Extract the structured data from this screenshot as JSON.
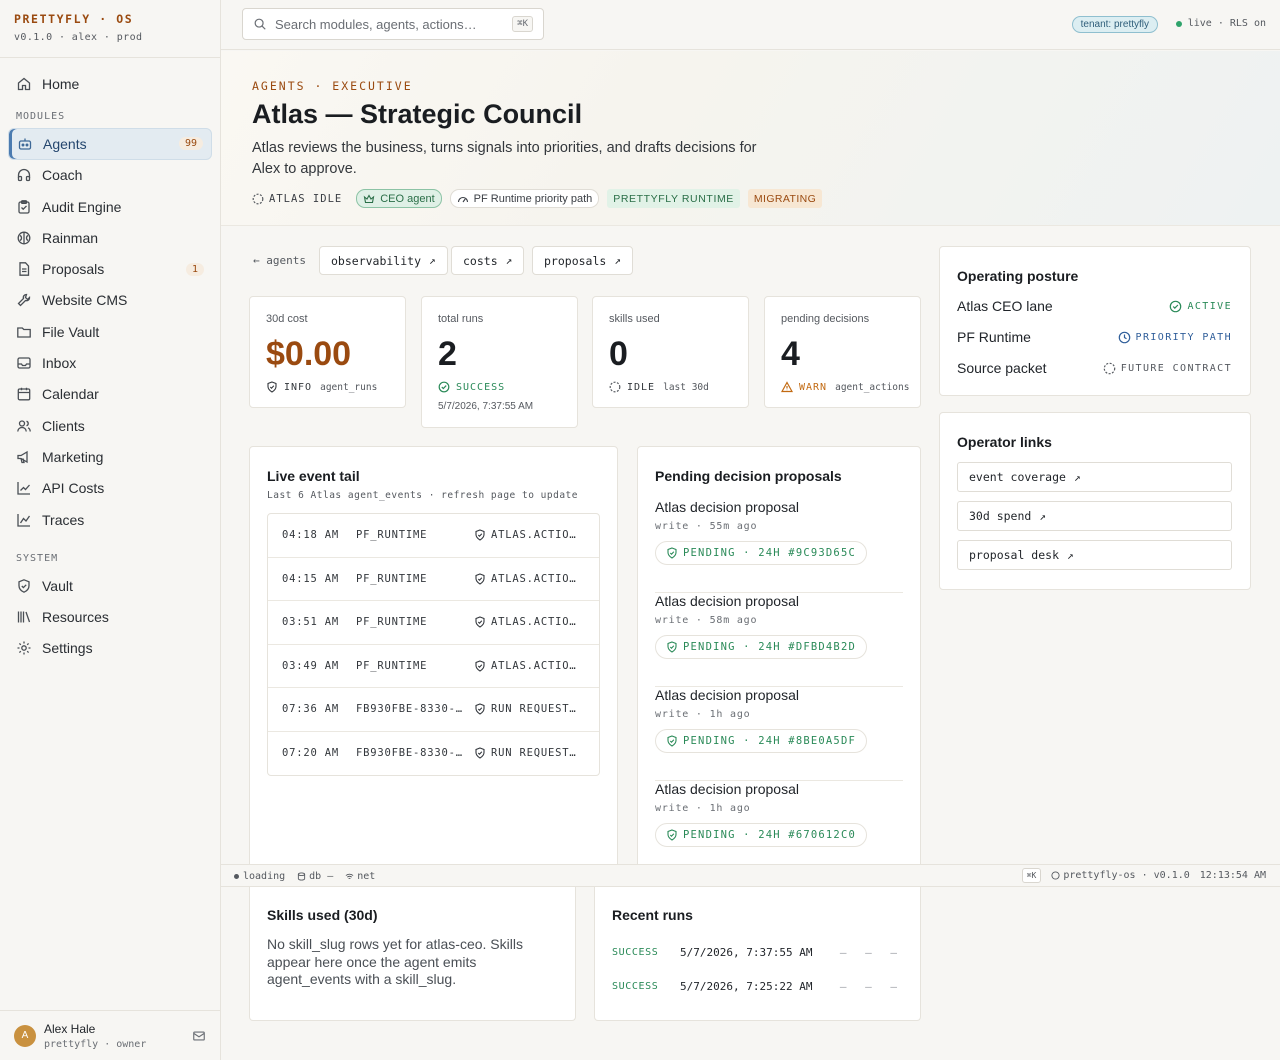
{
  "app": {
    "brand": "PRETTYFLY · OS",
    "version_line": "v0.1.0 · alex · prod"
  },
  "sidebar": {
    "home": "Home",
    "modules_label": "MODULES",
    "modules": [
      {
        "label": "Agents",
        "badge": "99"
      },
      {
        "label": "Coach"
      },
      {
        "label": "Audit Engine"
      },
      {
        "label": "Rainman"
      },
      {
        "label": "Proposals",
        "badge": "1"
      },
      {
        "label": "Website CMS"
      },
      {
        "label": "File Vault"
      },
      {
        "label": "Inbox"
      },
      {
        "label": "Calendar"
      },
      {
        "label": "Clients"
      },
      {
        "label": "Marketing"
      },
      {
        "label": "API Costs"
      },
      {
        "label": "Traces"
      }
    ],
    "system_label": "SYSTEM",
    "system": [
      {
        "label": "Vault"
      },
      {
        "label": "Resources"
      },
      {
        "label": "Settings"
      }
    ],
    "user": {
      "initial": "A",
      "name": "Alex Hale",
      "sub": "prettyfly · owner"
    }
  },
  "topbar": {
    "search_placeholder": "Search modules, agents, actions…",
    "search_kbd": "⌘K",
    "tenant": "tenant: prettyfly",
    "live": "live · RLS on"
  },
  "hero": {
    "eyebrow": "AGENTS · EXECUTIVE",
    "title": "Atlas — Strategic Council",
    "description": "Atlas reviews the business, turns signals into priorities, and drafts decisions for Alex to approve.",
    "chips": {
      "status": "ATLAS IDLE",
      "role": "CEO agent",
      "path": "PF Runtime priority path",
      "runtime": "PRETTYFLY RUNTIME",
      "migrating": "MIGRATING"
    }
  },
  "links": {
    "back": "← agents",
    "observability": "observability",
    "costs": "costs",
    "proposals": "proposals",
    "arrow": "↗"
  },
  "stats": [
    {
      "label": "30d cost",
      "value": "$0.00",
      "status": "INFO",
      "sub": "agent_runs"
    },
    {
      "label": "total runs",
      "value": "2",
      "status": "SUCCESS",
      "date": "5/7/2026, 7:37:55 AM"
    },
    {
      "label": "skills used",
      "value": "0",
      "status": "IDLE",
      "sub": "last 30d"
    },
    {
      "label": "pending decisions",
      "value": "4",
      "status": "WARN",
      "sub": "agent_actions"
    }
  ],
  "posture": {
    "title": "Operating posture",
    "rows": [
      {
        "label": "Atlas CEO lane",
        "status": "ACTIVE"
      },
      {
        "label": "PF Runtime",
        "status": "PRIORITY PATH"
      },
      {
        "label": "Source packet",
        "status": "FUTURE CONTRACT"
      }
    ]
  },
  "operator_links": {
    "title": "Operator links",
    "items": [
      "event coverage",
      "30d spend",
      "proposal desk"
    ]
  },
  "event_tail": {
    "title": "Live event tail",
    "subtitle": "Last 6 Atlas agent_events · refresh page to update",
    "rows": [
      {
        "time": "04:18 AM",
        "source": "PF_RUNTIME",
        "event": "ATLAS.ACTIO…"
      },
      {
        "time": "04:15 AM",
        "source": "PF_RUNTIME",
        "event": "ATLAS.ACTIO…"
      },
      {
        "time": "03:51 AM",
        "source": "PF_RUNTIME",
        "event": "ATLAS.ACTIO…"
      },
      {
        "time": "03:49 AM",
        "source": "PF_RUNTIME",
        "event": "ATLAS.ACTIO…"
      },
      {
        "time": "07:36 AM",
        "source": "FB930FBE-8330-…",
        "event": "RUN REQUEST…"
      },
      {
        "time": "07:20 AM",
        "source": "FB930FBE-8330-…",
        "event": "RUN REQUEST…"
      }
    ]
  },
  "proposals": {
    "title": "Pending decision proposals",
    "items": [
      {
        "title": "Atlas decision proposal",
        "sub": "write · 55m ago",
        "badge": "PENDING · 24H #9C93D65C"
      },
      {
        "title": "Atlas decision proposal",
        "sub": "write · 58m ago",
        "badge": "PENDING · 24H #DFBD4B2D"
      },
      {
        "title": "Atlas decision proposal",
        "sub": "write · 1h ago",
        "badge": "PENDING · 24H #8BE0A5DF"
      },
      {
        "title": "Atlas decision proposal",
        "sub": "write · 1h ago",
        "badge": "PENDING · 24H #670612C0"
      }
    ]
  },
  "statusbar": {
    "loading": "loading",
    "db": "db –",
    "net": "net",
    "kbd": "⌘K",
    "app": "prettyfly-os · v0.1.0",
    "clock": "12:13:54 AM"
  },
  "skills": {
    "title": "Skills used (30d)",
    "body": "No skill_slug rows yet for atlas-ceo. Skills appear here once the agent emits agent_events with a skill_slug."
  },
  "recent_runs": {
    "title": "Recent runs",
    "rows": [
      {
        "status": "SUCCESS",
        "date": "5/7/2026, 7:37:55 AM",
        "dashes": "– – –"
      },
      {
        "status": "SUCCESS",
        "date": "5/7/2026, 7:25:22 AM",
        "dashes": "– – –"
      }
    ]
  },
  "colors": {
    "accent": "#9a4a10",
    "success": "#2a8a58",
    "warn": "#c26a12",
    "active_nav": "#e3ebf1"
  }
}
